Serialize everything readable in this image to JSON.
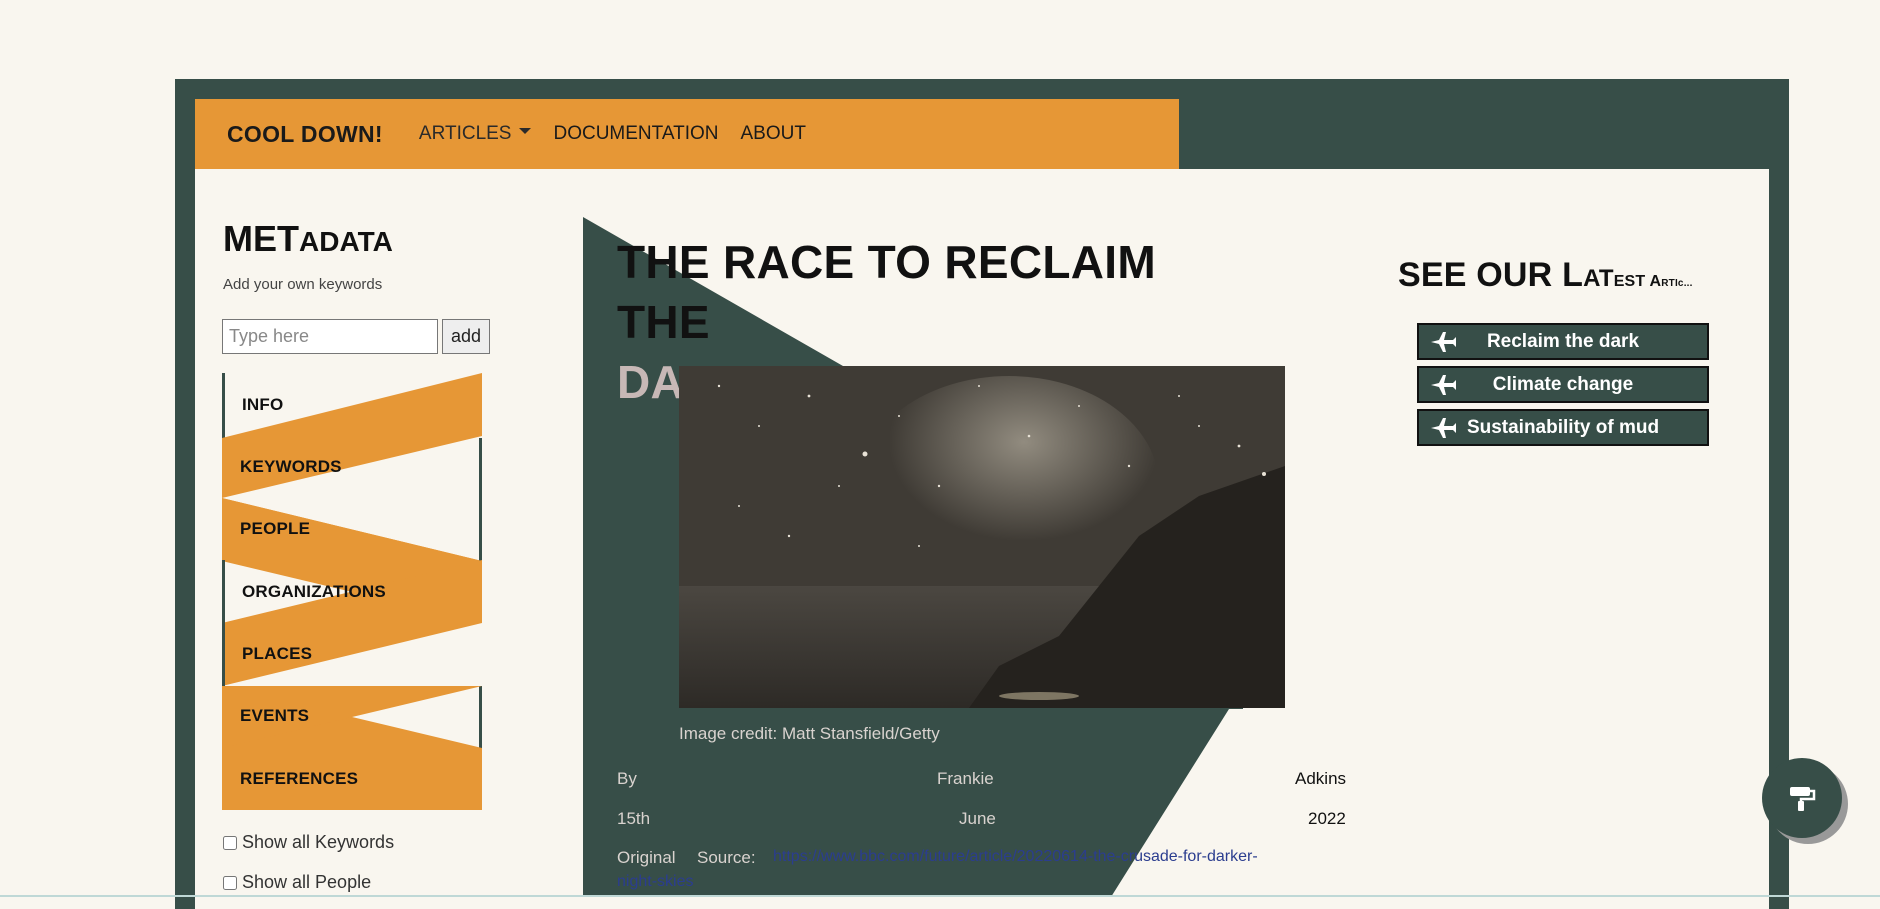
{
  "navbar": {
    "brand": "COOL DOWN!",
    "items": [
      "ARTICLES",
      "DOCUMENTATION",
      "ABOUT"
    ]
  },
  "sidebar": {
    "title_big": "MET",
    "title_small": "ADATA",
    "subtitle": "Add your own keywords",
    "input_placeholder": "Type here",
    "add_label": "add",
    "menu": [
      "INFO",
      "KEYWORDS",
      "PEOPLE",
      "ORGANIZATIONS",
      "PLACES",
      "EVENTS",
      "REFERENCES"
    ],
    "checkboxes": [
      "Show all Keywords",
      "Show all People"
    ]
  },
  "article": {
    "title_line1": "THE RACE TO RECLAIM THE",
    "title_line2": "DARK",
    "image_credit": "Image credit: Matt Stansfield/Getty",
    "by_label": "By",
    "author_first": "Frankie",
    "author_last": "Adkins",
    "date_day": "15th",
    "date_month": "June",
    "date_year": "2022",
    "source_label_1": "Original",
    "source_label_2": "Source:",
    "source_url_line1": "https://www.bbc.com/future/article/20220614-the-crusade-for-darker-",
    "source_url_line2": "night-skies"
  },
  "latest": {
    "title_big": "SEE OUR L",
    "title_s1": "AT",
    "title_s2": "EST A",
    "title_s3": "RTIc...",
    "buttons": [
      "Reclaim the dark",
      "Climate change",
      "Sustainability of mud"
    ]
  },
  "colors": {
    "accent": "#e69736",
    "frame": "#374e48",
    "background": "#f9f6ef"
  },
  "icons": {
    "fab": "paint-roller-icon",
    "latest": "airplane-icon"
  }
}
